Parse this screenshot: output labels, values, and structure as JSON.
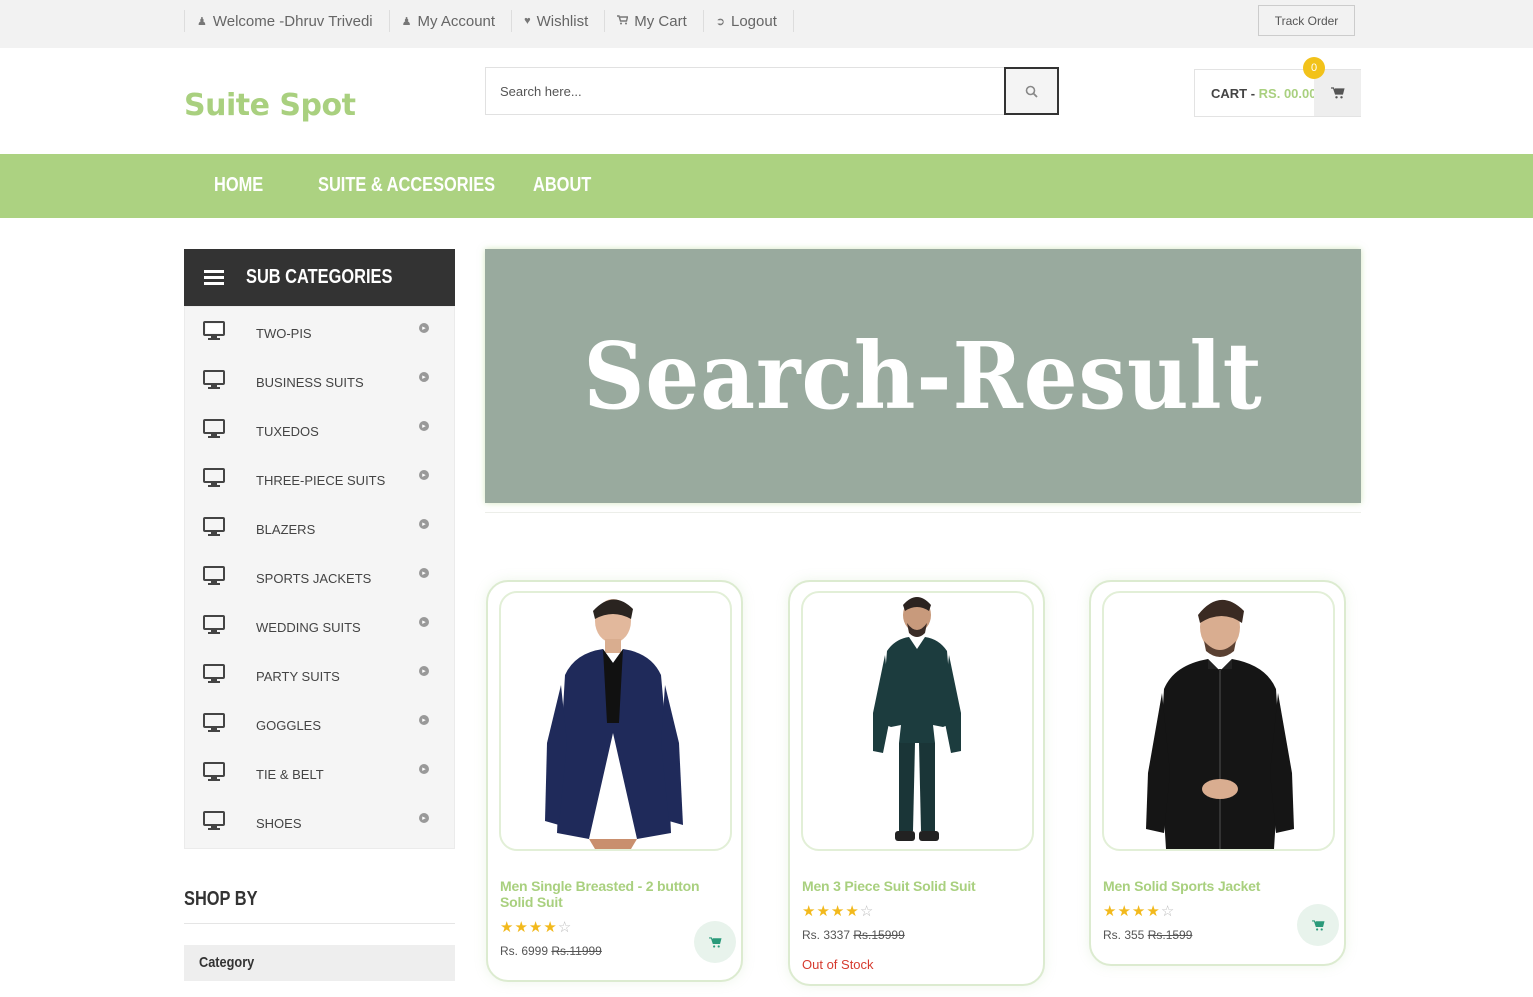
{
  "topbar": {
    "items": [
      {
        "icon": "user-icon",
        "label": "Welcome -Dhruv Trivedi"
      },
      {
        "icon": "user-icon",
        "label": "My Account"
      },
      {
        "icon": "heart-icon",
        "label": "Wishlist"
      },
      {
        "icon": "cart-icon",
        "label": "My Cart"
      },
      {
        "icon": "logout-icon",
        "label": "Logout"
      }
    ],
    "track_order": "Track Order"
  },
  "header": {
    "logo": "Suite Spot",
    "search": {
      "placeholder": "Search here..."
    },
    "cart": {
      "label": "CART - ",
      "amount": "RS. 00.00",
      "count": "0"
    }
  },
  "nav": {
    "items": [
      "HOME",
      "SUITE & ACCESORIES",
      "ABOUT"
    ]
  },
  "sidebar": {
    "title": "SUB CATEGORIES",
    "items": [
      {
        "label": "TWO-PIS"
      },
      {
        "label": "BUSINESS SUITS"
      },
      {
        "label": "TUXEDOS"
      },
      {
        "label": "THREE-PIECE SUITS"
      },
      {
        "label": "BLAZERS"
      },
      {
        "label": "SPORTS JACKETS"
      },
      {
        "label": "WEDDING SUITS"
      },
      {
        "label": "PARTY SUITS"
      },
      {
        "label": "GOGGLES"
      },
      {
        "label": "TIE & BELT"
      },
      {
        "label": "SHOES"
      }
    ],
    "shop_by": "SHOP BY",
    "category": "Category"
  },
  "banner": {
    "title": "Search-Result"
  },
  "colors": {
    "accent": "#a9d07f",
    "nav_bg": "#acd281",
    "banner_bg": "#99aa9e",
    "star": "#f2b91c",
    "out_of_stock": "#d63b2f"
  },
  "products": [
    {
      "name": "Men Single Breasted - 2 button Solid Suit",
      "rating": 4,
      "price": "Rs. 6999",
      "old_price": "Rs.11999",
      "stock": ""
    },
    {
      "name": "Men 3 Piece Suit Solid Suit",
      "rating": 4,
      "price": "Rs. 3337",
      "old_price": "Rs.15999",
      "stock": "Out of Stock"
    },
    {
      "name": "Men Solid Sports Jacket",
      "rating": 4,
      "price": "Rs. 355",
      "old_price": "Rs.1599",
      "stock": ""
    }
  ]
}
